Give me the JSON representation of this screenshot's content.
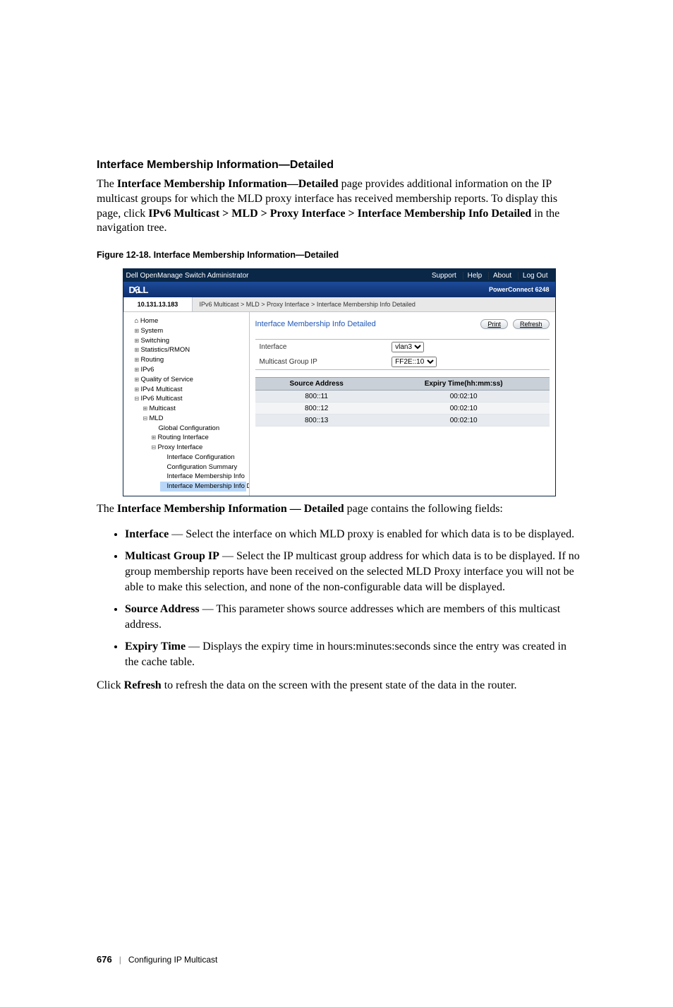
{
  "heading": "Interface Membership Information—Detailed",
  "intro_p1_a": "The ",
  "intro_p1_b": "Interface Membership Information—Detailed",
  "intro_p1_c": " page provides additional information on the IP multicast groups for which the MLD proxy interface has received membership reports. To display this page, click ",
  "intro_p1_d": "IPv6 Multicast > MLD > Proxy Interface > Interface Membership Info Detailed",
  "intro_p1_e": " in the navigation tree.",
  "figcap": "Figure 12-18.    Interface Membership Information—Detailed",
  "app": {
    "title": "Dell OpenManage Switch Administrator",
    "links": {
      "support": "Support",
      "help": "Help",
      "about": "About",
      "logout": "Log Out"
    },
    "logo_text_d": "D",
    "logo_text_e": "E",
    "logo_text_ll": "LL",
    "model": "PowerConnect 6248",
    "ip": "10.131.13.183",
    "crumb": "IPv6 Multicast > MLD > Proxy Interface > Interface Membership Info Detailed",
    "tree": {
      "home": "Home",
      "system": "System",
      "switching": "Switching",
      "stats": "Statistics/RMON",
      "routing": "Routing",
      "ipv6": "IPv6",
      "qos": "Quality of Service",
      "ipv4mc": "IPv4 Multicast",
      "ipv6mc": "IPv6 Multicast",
      "multicast": "Multicast",
      "mld": "MLD",
      "globalcfg": "Global Configuration",
      "routingif": "Routing Interface",
      "proxyif": "Proxy Interface",
      "ifcfg": "Interface Configuration",
      "cfgsum": "Configuration Summary",
      "ifmem": "Interface Membership Info",
      "ifmemd": "Interface Membership Info Detailed"
    },
    "pane": {
      "title": "Interface Membership Info Detailed",
      "print": "Print",
      "refresh": "Refresh",
      "interface_label": "Interface",
      "interface_value": "vlan3",
      "mcast_label": "Multicast Group IP",
      "mcast_value": "FF2E::10",
      "table": {
        "col1": "Source Address",
        "col2": "Expiry Time(hh:mm:ss)",
        "rows": [
          {
            "addr": "800::11",
            "exp": "00:02:10"
          },
          {
            "addr": "800::12",
            "exp": "00:02:10"
          },
          {
            "addr": "800::13",
            "exp": "00:02:10"
          }
        ]
      }
    }
  },
  "post_p_a": "The ",
  "post_p_b": "Interface Membership Information — Detailed",
  "post_p_c": " page contains the following fields:",
  "b1h": "Interface",
  "b1t": " — Select the interface on which MLD proxy is enabled for which data is to be displayed.",
  "b2h": "Multicast Group IP",
  "b2t": " — Select the IP multicast group address for which data is to be displayed. If no group membership reports have been received on the selected MLD Proxy interface you will not be able to make this selection, and none of the non-configurable data will be displayed.",
  "b3h": "Source Address",
  "b3t": " — This parameter shows source addresses which are members of this multicast address.",
  "b4h": "Expiry Time",
  "b4t": " — Displays the expiry time in hours:minutes:seconds since the entry was created in the cache table.",
  "refresh_a": "Click ",
  "refresh_b": "Refresh",
  "refresh_c": " to refresh the data on the screen with the present state of the data in the router.",
  "footer": {
    "page": "676",
    "section": "Configuring IP Multicast"
  }
}
